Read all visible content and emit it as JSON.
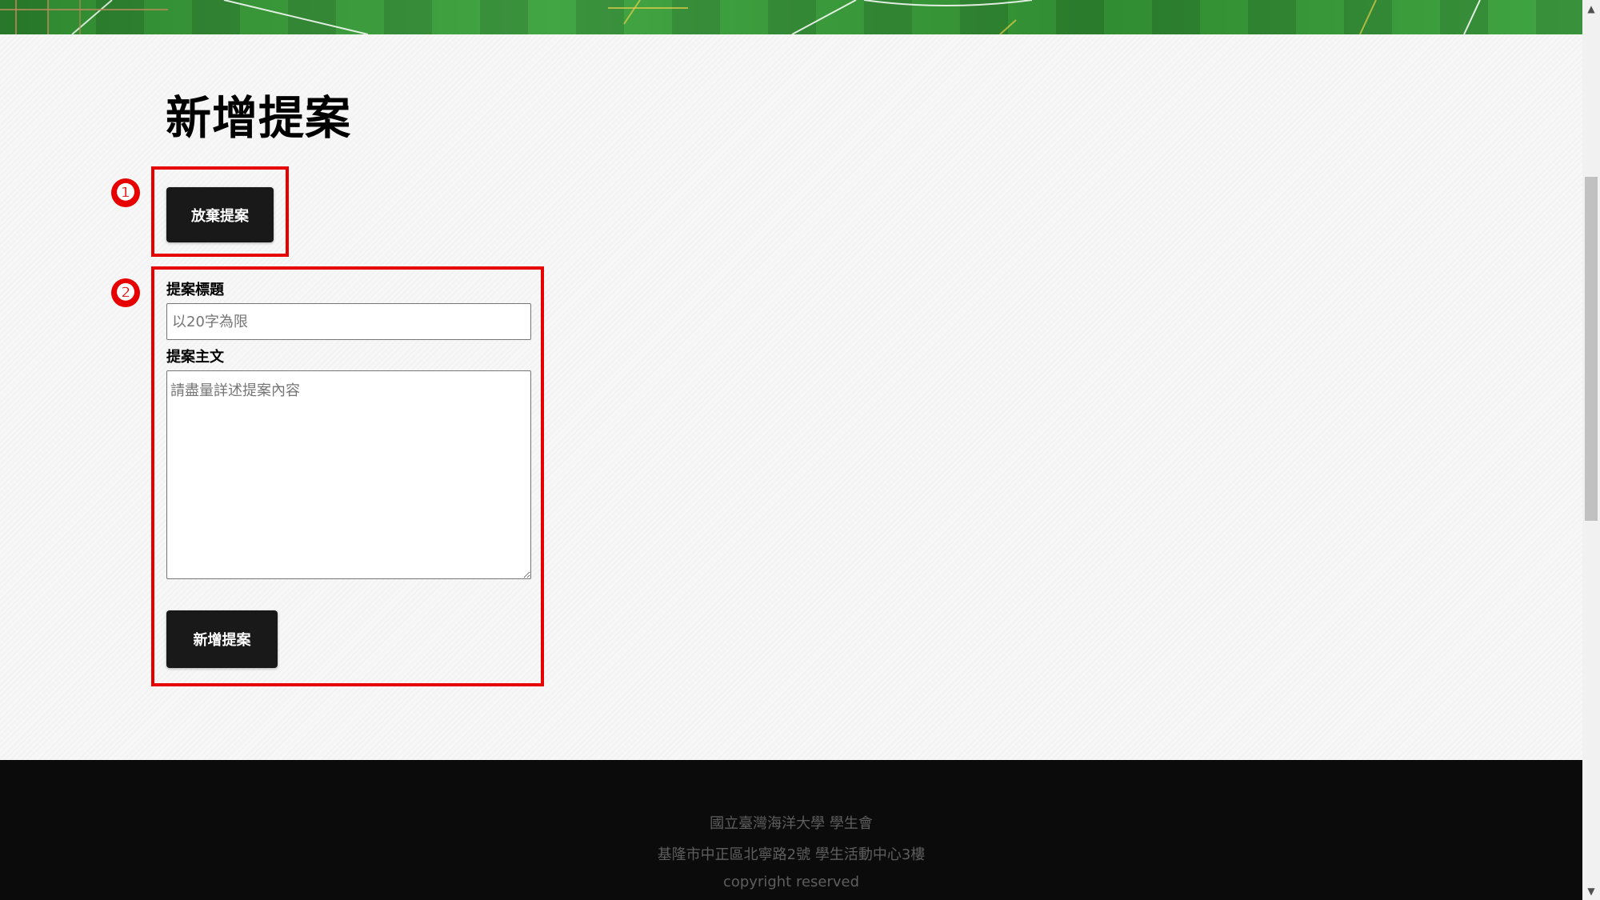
{
  "page": {
    "title": "新增提案"
  },
  "annotations": {
    "marker_1": "❶",
    "marker_2": "❷"
  },
  "actions": {
    "abandon_label": "放棄提案",
    "submit_label": "新增提案"
  },
  "form": {
    "title_label": "提案標題",
    "title_value": "",
    "title_placeholder": "以20字為限",
    "body_label": "提案主文",
    "body_value": "",
    "body_placeholder": "請盡量詳述提案內容"
  },
  "footer": {
    "organization": "國立臺灣海洋大學 學生會",
    "address": "基隆市中正區北寧路2號 學生活動中心3樓",
    "copyright": "copyright reserved"
  },
  "scrollbar": {
    "up_icon": "▲",
    "down_icon": "▼"
  },
  "colors": {
    "annotation_red": "#e60000",
    "button_dark": "#191919",
    "footer_bg": "#0b0b0b"
  }
}
